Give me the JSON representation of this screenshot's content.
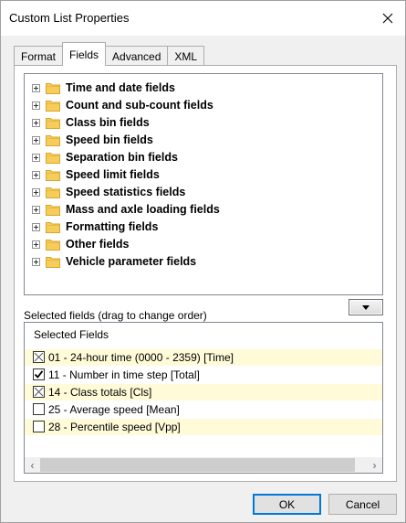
{
  "window": {
    "title": "Custom List Properties"
  },
  "tabs": [
    {
      "label": "Format",
      "active": false
    },
    {
      "label": "Fields",
      "active": true
    },
    {
      "label": "Advanced",
      "active": false
    },
    {
      "label": "XML",
      "active": false
    }
  ],
  "tree": {
    "items": [
      {
        "label": "Time and date fields",
        "icon": "folder-icon"
      },
      {
        "label": "Count and sub-count fields",
        "icon": "folder-icon"
      },
      {
        "label": "Class bin fields",
        "icon": "folder-icon"
      },
      {
        "label": "Speed bin fields",
        "icon": "folder-icon"
      },
      {
        "label": "Separation bin fields",
        "icon": "folder-icon"
      },
      {
        "label": "Speed limit fields",
        "icon": "folder-icon"
      },
      {
        "label": "Speed statistics fields",
        "icon": "folder-icon"
      },
      {
        "label": "Mass and axle loading fields",
        "icon": "folder-icon"
      },
      {
        "label": "Formatting fields",
        "icon": "folder-icon"
      },
      {
        "label": "Other fields",
        "icon": "folder-icon"
      },
      {
        "label": "Vehicle parameter fields",
        "icon": "folder-icon"
      }
    ]
  },
  "selected": {
    "caption": "Selected fields (drag to change order)",
    "header": "Selected Fields",
    "rows": [
      {
        "label": "01 - 24-hour time (0000 - 2359) [Time]",
        "state": "crossed",
        "tinted": true
      },
      {
        "label": "11 - Number in time step [Total]",
        "state": "checked",
        "tinted": false
      },
      {
        "label": "14 - Class totals [Cls]",
        "state": "crossed",
        "tinted": true
      },
      {
        "label": "25 - Average speed [Mean]",
        "state": "unchecked",
        "tinted": false
      },
      {
        "label": "28 - Percentile speed [Vpp]",
        "state": "unchecked",
        "tinted": true
      }
    ]
  },
  "buttons": {
    "ok": "OK",
    "cancel": "Cancel"
  },
  "colors": {
    "folder": "#f6cd5b",
    "row_tint": "#fffbd8",
    "ok_border": "#0078d7"
  }
}
